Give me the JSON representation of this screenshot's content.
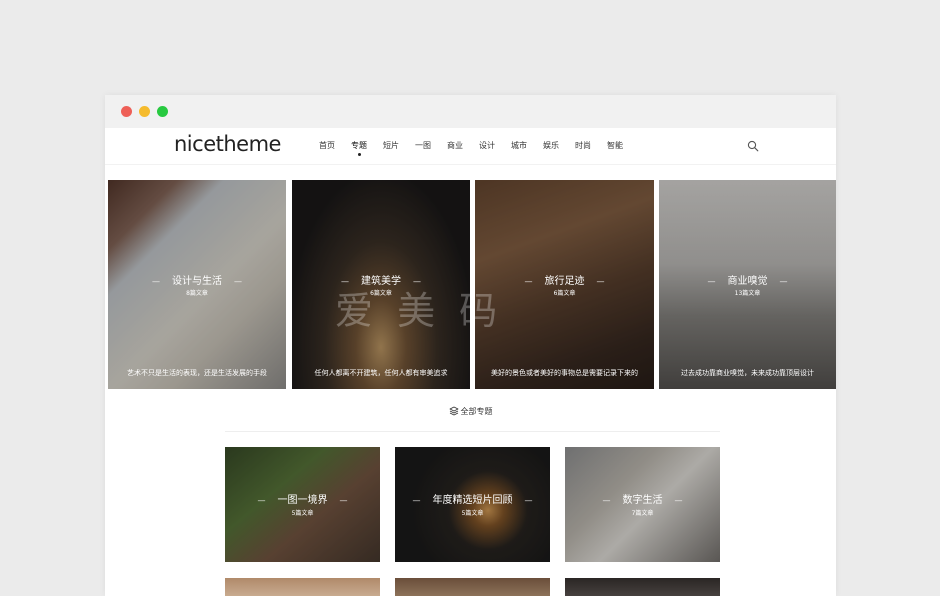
{
  "brand": {
    "logo": "nicetheme"
  },
  "nav": [
    "首页",
    "专题",
    "短片",
    "一图",
    "商业",
    "设计",
    "城市",
    "娱乐",
    "时尚",
    "智能"
  ],
  "featured": [
    {
      "title": "设计与生活",
      "count": "8篇文章",
      "desc": "艺术不只是生活的表现，还是生活发展的手段"
    },
    {
      "title": "建筑美学",
      "count": "6篇文章",
      "desc": "任何人都离不开建筑，任何人都有审美追求"
    },
    {
      "title": "旅行足迹",
      "count": "6篇文章",
      "desc": "美好的景色或者美好的事物总是需要记录下来的"
    },
    {
      "title": "商业嗅觉",
      "count": "13篇文章",
      "desc": "过去成功靠商业嗅觉，未来成功靠顶层设计"
    }
  ],
  "section": {
    "label": "全部专题"
  },
  "grid": [
    {
      "title": "一图一境界",
      "count": "5篇文章"
    },
    {
      "title": "年度精选短片回顾",
      "count": "5篇文章"
    },
    {
      "title": "数字生活",
      "count": "7篇文章"
    },
    {
      "title": "",
      "count": ""
    },
    {
      "title": "",
      "count": ""
    },
    {
      "title": "",
      "count": ""
    }
  ],
  "watermark": "爱 美 码"
}
